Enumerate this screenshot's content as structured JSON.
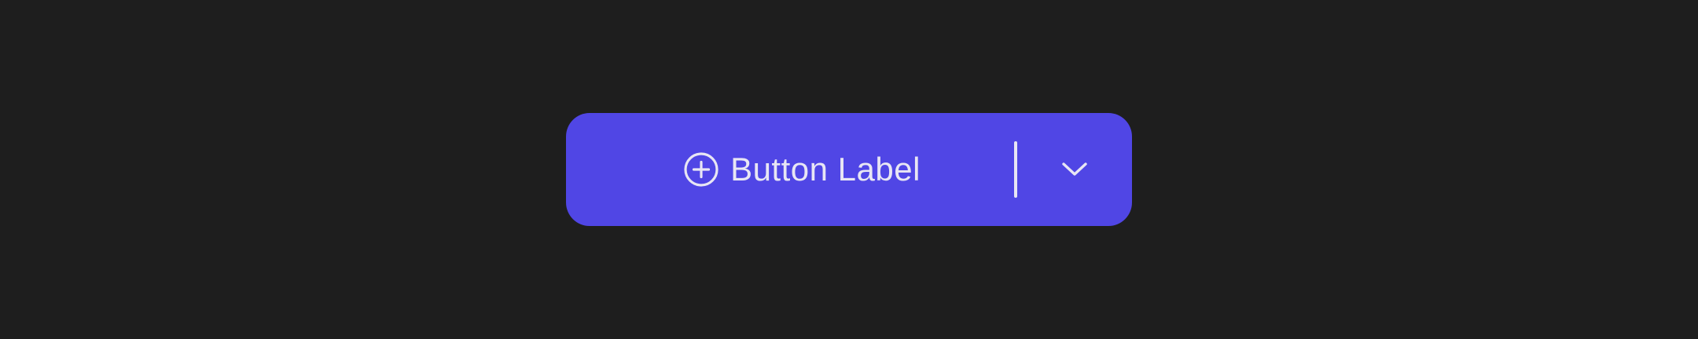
{
  "split_button": {
    "label": "Button Label",
    "primary_icon": "plus-circle-icon",
    "dropdown_icon": "chevron-down-icon"
  },
  "colors": {
    "background": "#1e1e1e",
    "button": "#5046e5",
    "foreground": "#e8e6f4"
  }
}
